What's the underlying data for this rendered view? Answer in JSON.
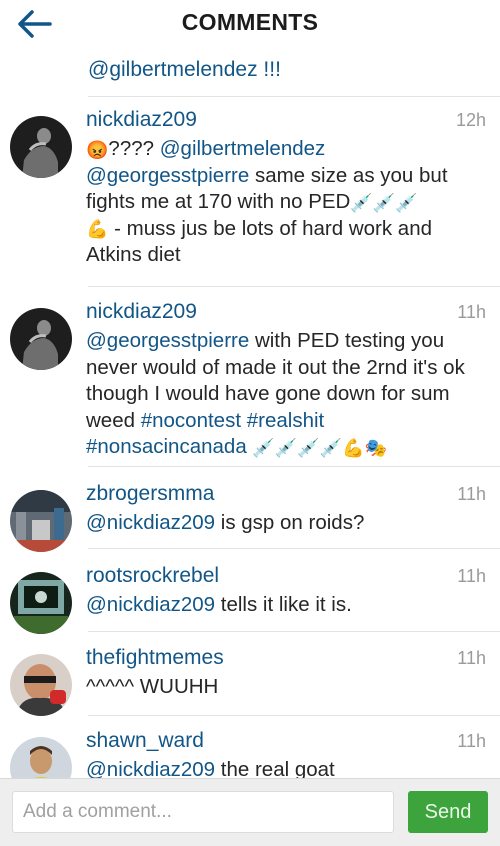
{
  "header": {
    "title": "COMMENTS",
    "back_icon": "back-arrow-icon"
  },
  "partial_comment": "@gilbertmelendez !!!",
  "comments": [
    {
      "user": "nickdiaz209",
      "time": "12h",
      "parts": [
        "????",
        "@gilbertmelendez",
        "@georgesstpierre",
        "same size as you but fights me at 170 with no PED",
        "- muss jus be lots of hard work and Atkins diet"
      ]
    },
    {
      "user": "nickdiaz209",
      "time": "11h",
      "parts": [
        "@georgesstpierre",
        "with PED testing you never would of made it out the 2rnd it's ok though I would have gone down for sum weed",
        "#nocontest",
        "#realshit",
        "#nonsacincanada"
      ]
    },
    {
      "user": "zbrogersmma",
      "time": "11h",
      "parts": [
        "@nickdiaz209",
        "is gsp on roids?"
      ]
    },
    {
      "user": "rootsrockrebel",
      "time": "11h",
      "parts": [
        "@nickdiaz209",
        "tells it like it is."
      ]
    },
    {
      "user": "thefightmemes",
      "time": "11h",
      "parts": [
        "^^^^^ WUUHH"
      ]
    },
    {
      "user": "shawn_ward",
      "time": "11h",
      "parts": [
        "@nickdiaz209",
        "the real goat"
      ]
    }
  ],
  "emoji": {
    "angry": "😡",
    "syringe": "💉",
    "muscle": "💪",
    "masks": "🎭"
  },
  "footer": {
    "placeholder": "Add a comment...",
    "send_label": "Send"
  },
  "colors": {
    "link": "#125688",
    "send": "#3da33d"
  }
}
